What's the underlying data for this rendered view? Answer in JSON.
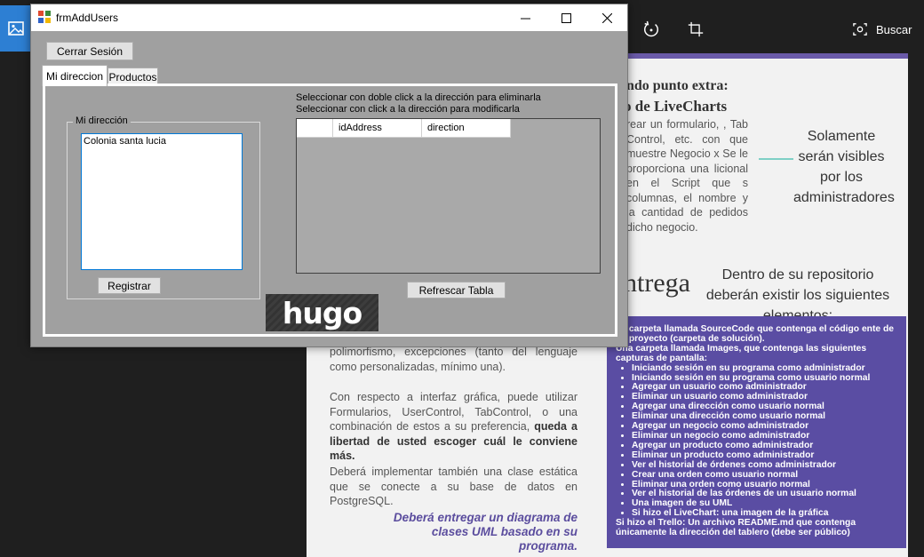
{
  "viewer": {
    "buscar_label": "Buscar",
    "icons": [
      "image-icon",
      "rotate-icon",
      "crop-icon",
      "visual-search-icon"
    ]
  },
  "document": {
    "heading_punto_extra": "ndo punto extra:",
    "heading_livecharts": "o de LiveCharts",
    "para_livecharts": "rear un formulario, , Tab Control, etc. con que muestre Negocio x Se le proporciona una licional en el Script que s columnas, el nombre y la cantidad de pedidos dicho negocio.",
    "callout_admin": "Solamente serán visibles por los administradores",
    "heading_entrega": "ntrega",
    "callout_repo": "Dentro de su repositorio deberán existir los siguientes elementos:",
    "para_polimorfismo": "polimorfismo, excepciones (tanto del lenguaje como personalizadas, mínimo una).",
    "para_interfaz_start": "Con respecto a interfaz gráfica, puede utilizar Formularios, UserControl, TabControl, o una combinación de estos a su preferencia,",
    "para_interfaz_bold": "queda a libertad de usted escoger cuál le conviene más.",
    "para_clase": "Deberá implementar también una clase estática que se conecte a su base de datos en PostgreSQL.",
    "italic_note": "Deberá entregar un diagrama de clases UML basado en su programa.",
    "purple_intro_1": "na carpeta llamada SourceCode que contenga el código ente de su proyecto (carpeta de solución).",
    "purple_intro_2": "Una carpeta llamada Images, que contenga las siguientes capturas de pantalla:",
    "purple_items": [
      "Iniciando sesión en su programa como administrador",
      "Iniciando sesión en su programa como usuario normal",
      "Agregar un usuario como administrador",
      "Eliminar un usuario como administrador",
      "Agregar una dirección como usuario normal",
      "Eliminar una dirección como usuario normal",
      "Agregar un negocio como administrador",
      "Eliminar un negocio como administrador",
      "Agregar un producto como administrador",
      "Eliminar un producto como administrador",
      "Ver el historial de órdenes como administrador",
      "Crear una orden como usuario normal",
      "Eliminar una orden como usuario normal",
      "Ver el historial de las órdenes de un usuario normal",
      "Una imagen de su UML",
      "Si hizo el LiveChart: una imagen de la gráfica"
    ],
    "purple_outro": "Si hizo el Trello: Un archivo README.md que contenga únicamente la dirección del tablero (debe ser público)"
  },
  "window": {
    "title": "frmAddUsers",
    "cerrar_sesion": "Cerrar Sesión",
    "tabs": [
      {
        "label": "Mi direccion",
        "active": true
      },
      {
        "label": "Productos",
        "active": false
      }
    ],
    "groupbox_label": "Mi dirección",
    "address_value": "Colonia santa lucia",
    "registrar": "Registrar",
    "hint_line1": "Seleccionar con doble click a la dirección para eliminarla",
    "hint_line2": "Seleccionar con click a la dirección para modificarla",
    "grid_columns": [
      "",
      "idAddress",
      "direction"
    ],
    "refrescar": "Refrescar Tabla",
    "logo_text": "hugo"
  }
}
